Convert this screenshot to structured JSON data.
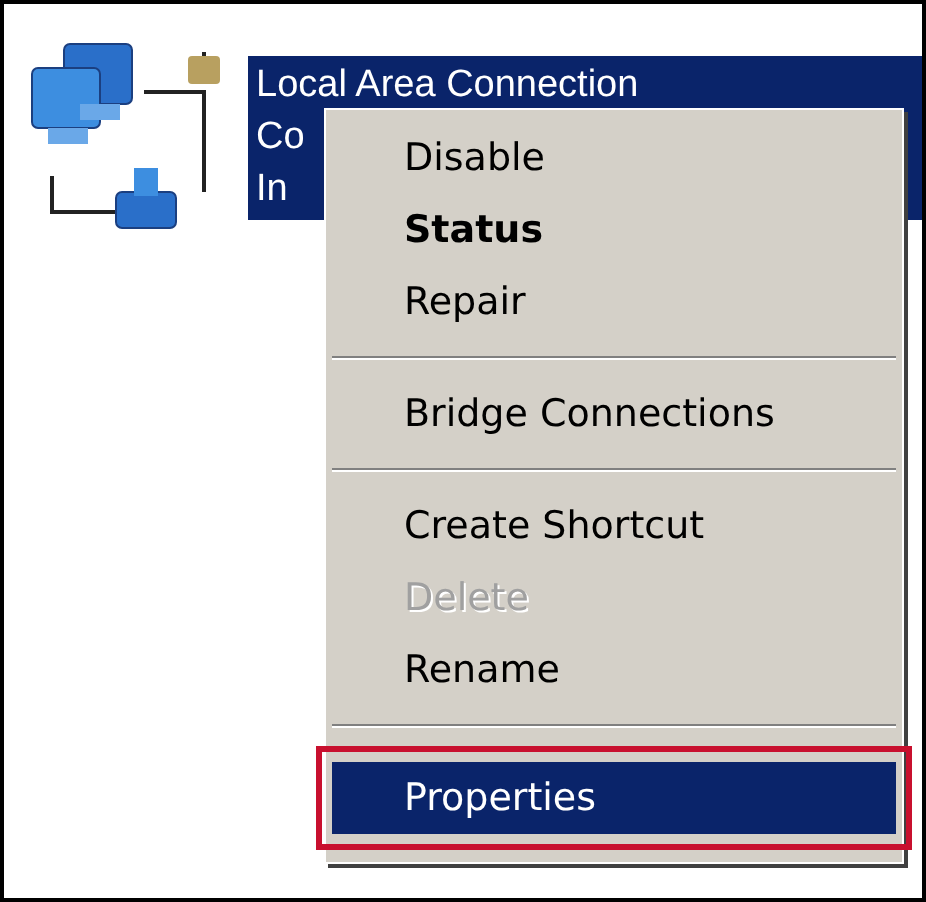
{
  "connection": {
    "lines": [
      "Local Area Connection",
      "Co",
      "In"
    ],
    "selected": true
  },
  "menu": [
    {
      "kind": "item",
      "label": "Disable",
      "bold": false,
      "disabled": false,
      "selected": false,
      "highlighted": false
    },
    {
      "kind": "item",
      "label": "Status",
      "bold": true,
      "disabled": false,
      "selected": false,
      "highlighted": false
    },
    {
      "kind": "item",
      "label": "Repair",
      "bold": false,
      "disabled": false,
      "selected": false,
      "highlighted": false
    },
    {
      "kind": "separator"
    },
    {
      "kind": "item",
      "label": "Bridge Connections",
      "bold": false,
      "disabled": false,
      "selected": false,
      "highlighted": false
    },
    {
      "kind": "separator"
    },
    {
      "kind": "item",
      "label": "Create Shortcut",
      "bold": false,
      "disabled": false,
      "selected": false,
      "highlighted": false
    },
    {
      "kind": "item",
      "label": "Delete",
      "bold": false,
      "disabled": true,
      "selected": false,
      "highlighted": false
    },
    {
      "kind": "item",
      "label": "Rename",
      "bold": false,
      "disabled": false,
      "selected": false,
      "highlighted": false
    },
    {
      "kind": "separator"
    },
    {
      "kind": "item",
      "label": "Properties",
      "bold": false,
      "disabled": false,
      "selected": true,
      "highlighted": true
    }
  ]
}
